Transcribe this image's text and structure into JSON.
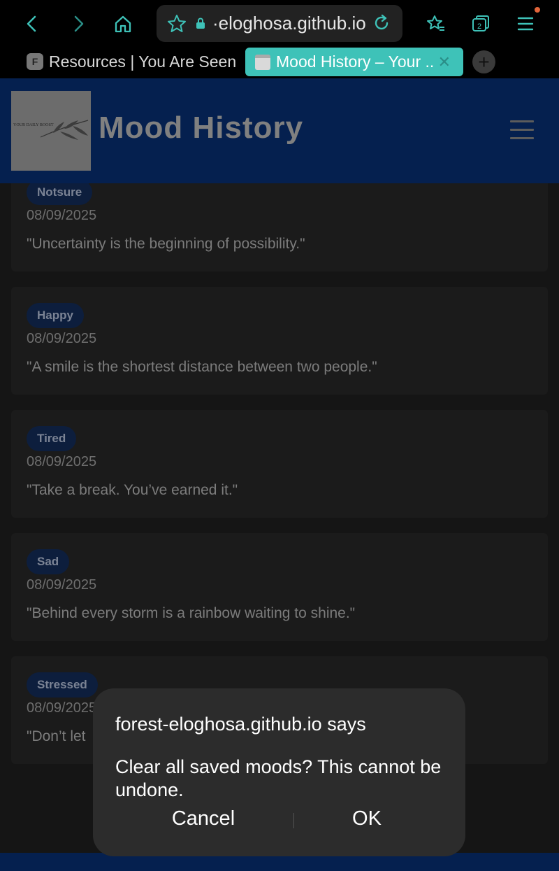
{
  "browser": {
    "url": "·eloghosa.github.io",
    "tabs": [
      {
        "favicon": "F",
        "label": "Resources | You Are Seen"
      },
      {
        "label": "Mood History – Your ...",
        "close": "✕"
      }
    ],
    "tab_count": "2",
    "new_tab": "+"
  },
  "header": {
    "logo_text": "YOUR DAILY BOOST",
    "title": "Mood History"
  },
  "moods": [
    {
      "mood": "Notsure",
      "date": "08/09/2025",
      "quote": "\"Uncertainty is the beginning of possibility.\""
    },
    {
      "mood": "Happy",
      "date": "08/09/2025",
      "quote": "\"A smile is the shortest distance between two people.\""
    },
    {
      "mood": "Tired",
      "date": "08/09/2025",
      "quote": "\"Take a break. You’ve earned it.\""
    },
    {
      "mood": "Sad",
      "date": "08/09/2025",
      "quote": "\"Behind every storm is a rainbow waiting to shine.\""
    },
    {
      "mood": "Stressed",
      "date": "08/09/2025",
      "quote": "\"Don’t let"
    }
  ],
  "dialog": {
    "title": "forest-eloghosa.github.io says",
    "message": "Clear all saved moods? This cannot be undone.",
    "cancel_label": "Cancel",
    "ok_label": "OK"
  },
  "colors": {
    "accent_tab": "#3ec2b8",
    "header_bg": "#05204f",
    "dialog_bg": "#2c2c2c"
  }
}
